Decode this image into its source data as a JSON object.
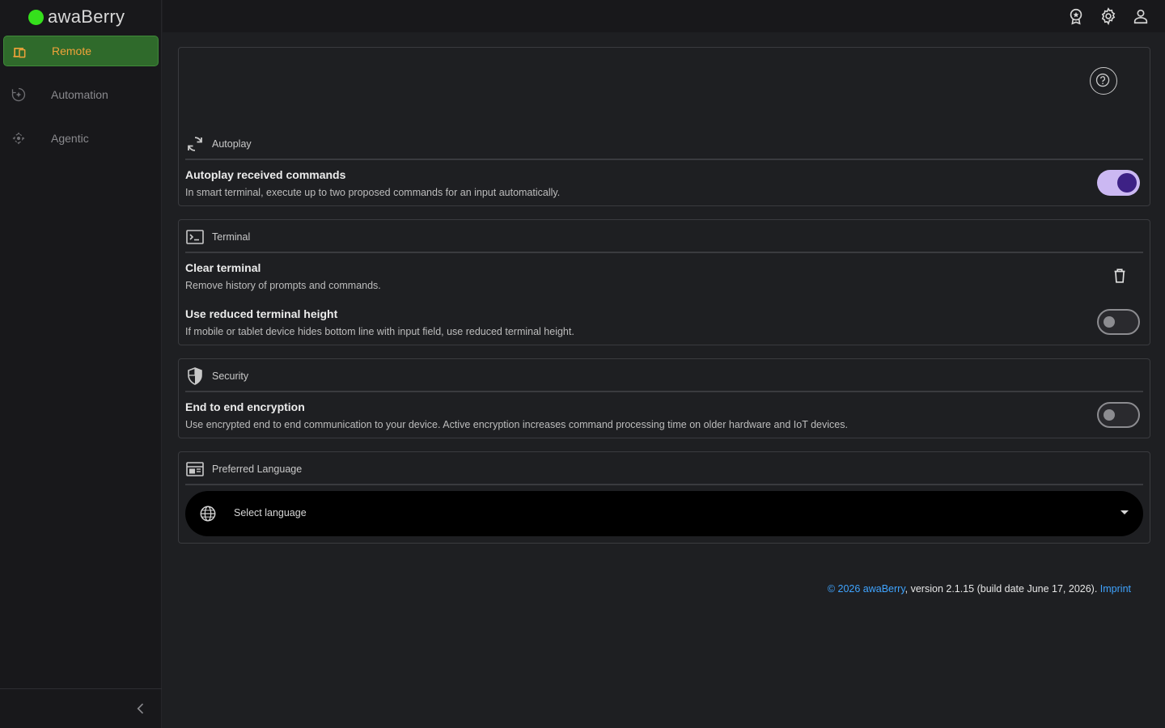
{
  "app": {
    "name": "awaBerry"
  },
  "sidebar": {
    "items": [
      {
        "label": "Remote",
        "icon": "devices-icon",
        "active": true
      },
      {
        "label": "Automation",
        "icon": "automation-icon",
        "active": false
      },
      {
        "label": "Agentic",
        "icon": "agentic-icon",
        "active": false
      }
    ],
    "collapse_icon": "chevron-left-icon"
  },
  "topbar": {
    "icons": [
      "award-icon",
      "gear-icon",
      "user-icon"
    ]
  },
  "help_icon": "help-icon",
  "sections": {
    "autoplay": {
      "label": "Autoplay",
      "icon": "sync-icon",
      "rows": [
        {
          "title": "Autoplay received commands",
          "description": "In smart terminal, execute up to two proposed commands for an input automatically.",
          "control": "toggle",
          "enabled": true
        }
      ]
    },
    "terminal": {
      "label": "Terminal",
      "icon": "terminal-icon",
      "rows": [
        {
          "title": "Clear terminal",
          "description": "Remove history of prompts and commands.",
          "control": "trash-icon"
        },
        {
          "title": "Use reduced terminal height",
          "description": "If mobile or tablet device hides bottom line with input field, use reduced terminal height.",
          "control": "toggle",
          "enabled": false
        }
      ]
    },
    "security": {
      "label": "Security",
      "icon": "shield-icon",
      "rows": [
        {
          "title": "End to end encryption",
          "description": "Use encrypted end to end communication to your device. Active encryption increases command processing time on older hardware and IoT devices.",
          "control": "toggle",
          "enabled": false
        }
      ]
    },
    "language": {
      "label": "Preferred Language",
      "icon": "web-panel-icon",
      "select": {
        "placeholder": "Select language",
        "icon": "globe-icon"
      }
    }
  },
  "footer": {
    "copyright_link": "© 2026 awaBerry",
    "version_text": ", version 2.1.15 (build date June 17, 2026). ",
    "imprint_link": "Imprint"
  },
  "colors": {
    "accent_green": "#2f6a2b",
    "active_label": "#f0a33a",
    "toggle_on_track": "#cbb8f2",
    "toggle_on_knob": "#3d2185",
    "link": "#3fa4ff",
    "logo_dot": "#35e01c"
  }
}
